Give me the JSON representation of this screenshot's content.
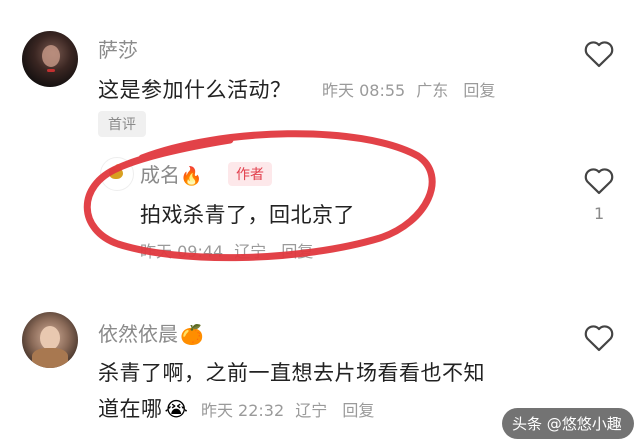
{
  "comments": [
    {
      "username": "萨莎",
      "text": "这是参加什么活动？",
      "time": "昨天 08:55",
      "location": "广东",
      "reply": "回复",
      "badge": "首评"
    },
    {
      "username": "成名",
      "username_emoji": "🔥",
      "author_tag": "作者",
      "text": "拍戏杀青了，回北京了",
      "time": "昨天 09:44",
      "location": "辽宁",
      "reply": "回复",
      "likes": "1"
    },
    {
      "username": "依然依晨",
      "username_emoji": "🍊",
      "text_line1": "杀青了啊，之前一直想去片场看看也不知",
      "text_line2": "道在哪",
      "text_emoji": "😭",
      "time": "昨天 22:32",
      "location": "辽宁",
      "reply": "回复"
    }
  ],
  "watermark": "头条 @悠悠小趣",
  "colors": {
    "annotation_circle": "#e0383e",
    "author_tag": "#e2404d"
  },
  "icons": {
    "like": "heart-outline-icon"
  }
}
